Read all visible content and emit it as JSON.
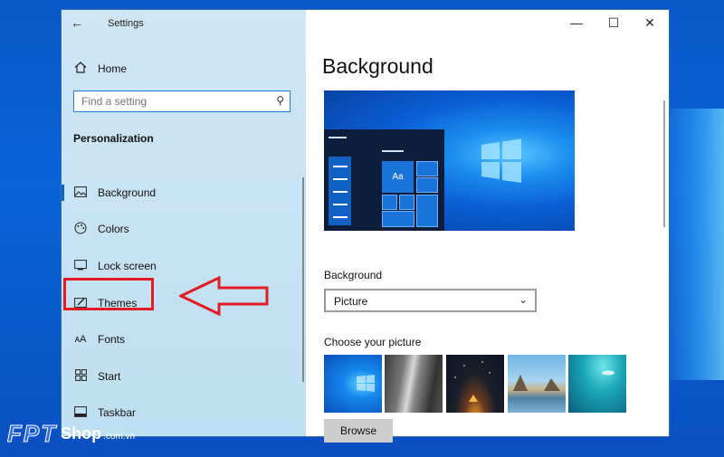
{
  "window": {
    "title": "Settings",
    "back_icon": "back-arrow-icon",
    "controls": [
      "—",
      "☐",
      "✕"
    ]
  },
  "sidebar": {
    "home_label": "Home",
    "search_placeholder": "Find a setting",
    "section_title": "Personalization",
    "items": [
      {
        "label": "Background",
        "icon": "picture-icon",
        "active": true
      },
      {
        "label": "Colors",
        "icon": "palette-icon",
        "active": false
      },
      {
        "label": "Lock screen",
        "icon": "lock-screen-icon",
        "active": false
      },
      {
        "label": "Themes",
        "icon": "themes-icon",
        "active": false
      },
      {
        "label": "Fonts",
        "icon": "fonts-icon",
        "active": false
      },
      {
        "label": "Start",
        "icon": "start-icon",
        "active": false
      },
      {
        "label": "Taskbar",
        "icon": "taskbar-icon",
        "active": false
      }
    ]
  },
  "content": {
    "heading": "Background",
    "preview_tile_text": "Aa",
    "background_label": "Background",
    "background_value": "Picture",
    "choose_label": "Choose your picture",
    "browse_label": "Browse",
    "thumbnails": [
      "windows-blue",
      "rock-waterfall",
      "night-sky-tent",
      "beach-rocks",
      "underwater-swimmer"
    ]
  },
  "watermark": {
    "brand": "FPT",
    "shop": "Shop",
    "domain": ".com.vn"
  },
  "colors": {
    "accent": "#0067c0",
    "highlight_red": "#e31b23",
    "sidebar_bg": "#c8e3f4"
  }
}
